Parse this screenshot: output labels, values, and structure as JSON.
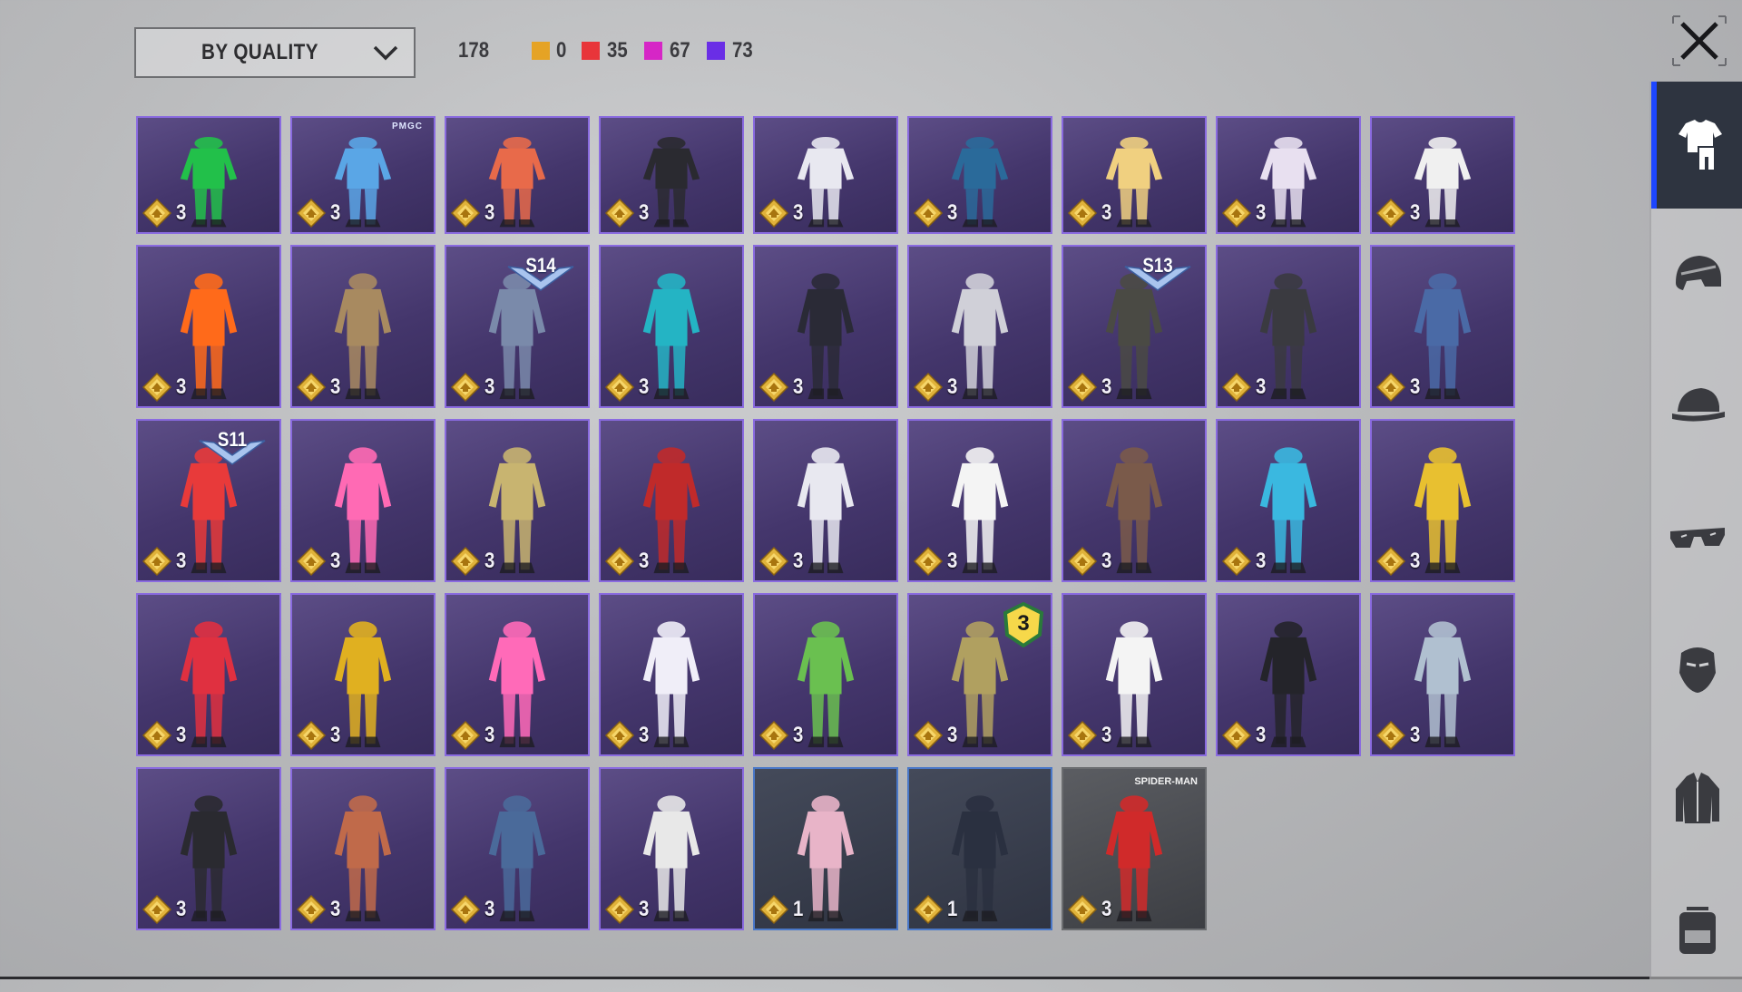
{
  "filter": {
    "sort_label": "BY QUALITY"
  },
  "counts": {
    "total": "178",
    "qualities": [
      {
        "color": "#e5a325",
        "value": "0"
      },
      {
        "color": "#e8353a",
        "value": "35"
      },
      {
        "color": "#d626c6",
        "value": "67"
      },
      {
        "color": "#6a2ee6",
        "value": "73"
      }
    ]
  },
  "sidebar": {
    "tabs": [
      {
        "icon": "outfit-icon",
        "active": true
      },
      {
        "icon": "helmet-icon",
        "active": false
      },
      {
        "icon": "cap-icon",
        "active": false
      },
      {
        "icon": "glasses-icon",
        "active": false
      },
      {
        "icon": "mask-icon",
        "active": false
      },
      {
        "icon": "jacket-icon",
        "active": false
      },
      {
        "icon": "backpack-icon",
        "active": false
      }
    ]
  },
  "items": [
    {
      "count": "3",
      "color": "#22c04a"
    },
    {
      "count": "3",
      "color": "#5aa6e6",
      "brand": "PMGC"
    },
    {
      "count": "3",
      "color": "#e86a4a"
    },
    {
      "count": "3",
      "color": "#2a2a30"
    },
    {
      "count": "3",
      "color": "#e8e8f0"
    },
    {
      "count": "3",
      "color": "#2a6a9a"
    },
    {
      "count": "3",
      "color": "#f0d080"
    },
    {
      "count": "3",
      "color": "#e8e0f0"
    },
    {
      "count": "3",
      "color": "#f0f0f0"
    },
    {
      "count": "3",
      "color": "#ff6a1a"
    },
    {
      "count": "3",
      "color": "#a88a60"
    },
    {
      "count": "3",
      "color": "#7a8aaa",
      "season": "S14"
    },
    {
      "count": "3",
      "color": "#24b4c4"
    },
    {
      "count": "3",
      "color": "#2a2a36"
    },
    {
      "count": "3",
      "color": "#d0d0d8"
    },
    {
      "count": "3",
      "color": "#4a4a44",
      "season": "S13"
    },
    {
      "count": "3",
      "color": "#3a3a40"
    },
    {
      "count": "3",
      "color": "#4a6aa6"
    },
    {
      "count": "3",
      "color": "#e83a3a",
      "season": "S11"
    },
    {
      "count": "3",
      "color": "#ff6ab4"
    },
    {
      "count": "3",
      "color": "#c8b470"
    },
    {
      "count": "3",
      "color": "#c02a2a"
    },
    {
      "count": "3",
      "color": "#e8e8f0"
    },
    {
      "count": "3",
      "color": "#f4f4f4"
    },
    {
      "count": "3",
      "color": "#7a5a4a"
    },
    {
      "count": "3",
      "color": "#3ab8e0"
    },
    {
      "count": "3",
      "color": "#e8c030"
    },
    {
      "count": "3",
      "color": "#e03040"
    },
    {
      "count": "3",
      "color": "#e0b020"
    },
    {
      "count": "3",
      "color": "#ff6ab8"
    },
    {
      "count": "3",
      "color": "#f0eef8"
    },
    {
      "count": "3",
      "color": "#6ac050"
    },
    {
      "count": "3",
      "color": "#b0a060",
      "level": "3"
    },
    {
      "count": "3",
      "color": "#f4f4f4"
    },
    {
      "count": "3",
      "color": "#24242a"
    },
    {
      "count": "3",
      "color": "#b0c0d0"
    },
    {
      "count": "3",
      "color": "#2a2a30"
    },
    {
      "count": "3",
      "color": "#c06a4a"
    },
    {
      "count": "3",
      "color": "#4a6a9a"
    },
    {
      "count": "3",
      "color": "#e8e8e8"
    },
    {
      "count": "1",
      "color": "#e8b4c8",
      "tier": "dark"
    },
    {
      "count": "1",
      "color": "#2a3040",
      "tier": "dark"
    },
    {
      "count": "3",
      "color": "#d02a2a",
      "tier": "grey",
      "logo": "SPIDER-MAN"
    }
  ]
}
